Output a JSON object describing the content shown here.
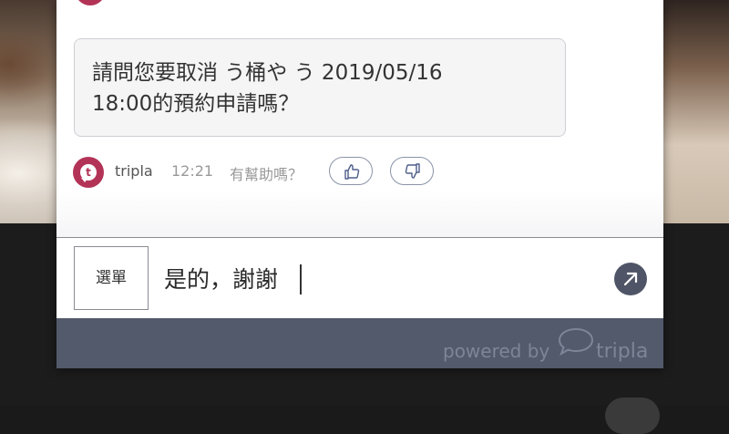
{
  "chat": {
    "message_lines": [
      "請問您要取消 う桶や う 2019/05/16",
      "18:00的預約申請嗎？"
    ],
    "bot_name": "tripla",
    "time": "12:21",
    "helpful_prompt": "有幫助嗎？"
  },
  "input_bar": {
    "menu_label": "選單",
    "message_value": "是的，謝謝"
  },
  "footer": {
    "powered_by": "powered by",
    "brand": "tripla"
  },
  "colors": {
    "brand_avatar": "#b33357",
    "footer_bg": "#525a6b",
    "send_button": "#4f5566"
  },
  "icons": [
    "thumbs-up-icon",
    "thumbs-down-icon",
    "send-arrow-icon",
    "tripla-speech-bubble-icon"
  ]
}
